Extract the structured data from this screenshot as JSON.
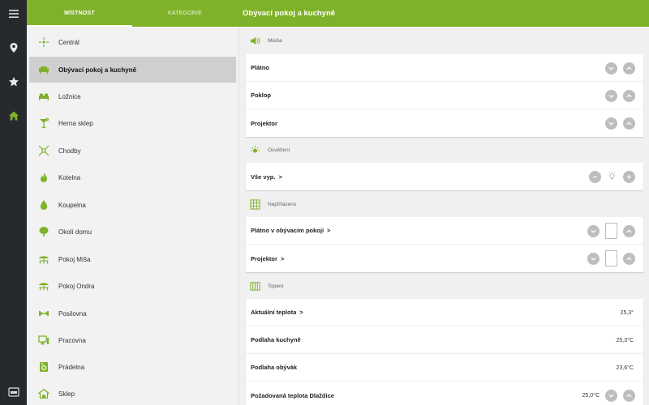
{
  "header": {
    "tabs": [
      {
        "label": "MÍSTNOST",
        "active": true
      },
      {
        "label": "KATEGORIE",
        "active": false
      }
    ],
    "title": "Obývací pokoj a kuchyně"
  },
  "rail": {
    "icons": [
      "menu-icon",
      "location-pin-icon",
      "star-icon",
      "home-icon",
      "sofa-icon"
    ]
  },
  "sidebar": {
    "items": [
      {
        "label": "Centrál",
        "icon": "central-icon"
      },
      {
        "label": "Obývací pokoj a kuchyně",
        "icon": "sofa-icon",
        "active": true
      },
      {
        "label": "Ložnice",
        "icon": "bed-icon"
      },
      {
        "label": "Herna sklep",
        "icon": "cocktail-icon"
      },
      {
        "label": "Chodby",
        "icon": "corridor-icon"
      },
      {
        "label": "Kotelna",
        "icon": "flame-icon"
      },
      {
        "label": "Koupelna",
        "icon": "drop-icon"
      },
      {
        "label": "Okolí domu",
        "icon": "tree-icon"
      },
      {
        "label": "Pokoj Míša",
        "icon": "umbrella-table-icon"
      },
      {
        "label": "Pokoj Ondra",
        "icon": "umbrella-table-icon"
      },
      {
        "label": "Posilovna",
        "icon": "dumbbell-icon"
      },
      {
        "label": "Pracovna",
        "icon": "monitor-icon"
      },
      {
        "label": "Prádelna",
        "icon": "washer-icon"
      },
      {
        "label": "Sklep",
        "icon": "cellar-icon"
      }
    ]
  },
  "sections": {
    "media": {
      "title": "Média",
      "rows": [
        {
          "label": "Plátno"
        },
        {
          "label": "Poklop"
        },
        {
          "label": "Projektor"
        }
      ]
    },
    "lighting": {
      "title": "Osvětlení",
      "rows": [
        {
          "label": "Vše vyp.",
          "arrow": ">"
        }
      ]
    },
    "unassigned": {
      "title": "Nepřiřazeno",
      "rows": [
        {
          "label": "Plátno v obývacím pokoji",
          "arrow": ">"
        },
        {
          "label": "Projektor",
          "arrow": ">"
        }
      ]
    },
    "heating": {
      "title": "Topení",
      "rows": [
        {
          "label": "Aktuální teplota",
          "arrow": ">",
          "value": "25,3°"
        },
        {
          "label": "Podlaha kuchyně",
          "value": "25,3°C"
        },
        {
          "label": "Podlaha obývák",
          "value": "23,6°C"
        },
        {
          "label": "Požadovaná teplota Dlaždice",
          "value": "25,0°C"
        }
      ]
    }
  },
  "colors": {
    "accent": "#7fb22a",
    "rail": "#262a2c",
    "button": "#bdbdbd"
  }
}
